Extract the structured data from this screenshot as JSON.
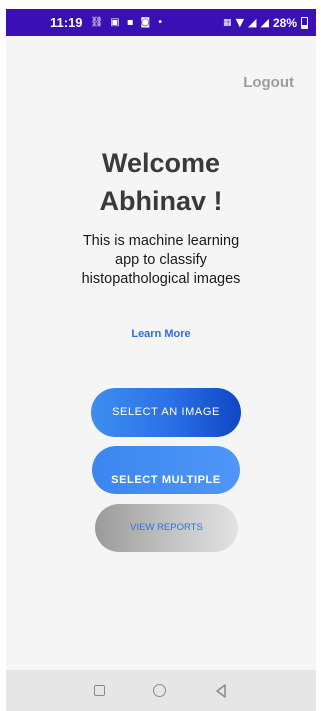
{
  "status_bar": {
    "time": "11:19",
    "left_icons": [
      "link-icon",
      "f-icon",
      "image-icon",
      "chat-icon",
      "dot-icon"
    ],
    "right_icons": [
      "volte-icon",
      "wifi-icon",
      "signal-icon",
      "signal-icon"
    ],
    "battery": "28%"
  },
  "header": {
    "logout_label": "Logout"
  },
  "main": {
    "welcome_line1": "Welcome",
    "welcome_line2": "Abhinav !",
    "description": "This is machine learning app to classify histopathological images",
    "learn_more_label": "Learn More"
  },
  "buttons": {
    "select_image": "SELECT AN IMAGE",
    "select_multiple": "SELECT MULTIPLE",
    "view_reports": "VIEW REPORTS"
  },
  "colors": {
    "status_bar": "#3a0fb3",
    "accent": "#2f6fe0",
    "logout": "#9e9e9e"
  }
}
